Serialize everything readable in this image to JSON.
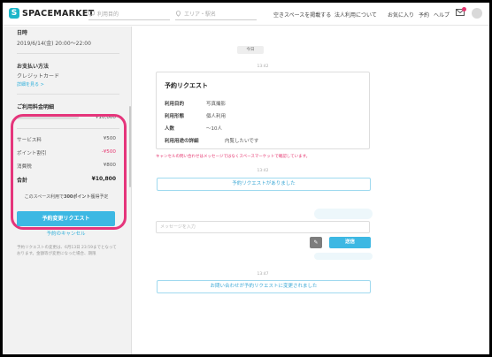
{
  "header": {
    "logo_text": "SPACEMARKET",
    "search_purpose_placeholder": "利用目的",
    "search_area_placeholder": "エリア・駅名",
    "nav": [
      "空きスペースを掲載する",
      "法人利用について",
      "お気に入り",
      "予約",
      "ヘルプ"
    ]
  },
  "sidebar": {
    "date_label": "日時",
    "date_value": "2019/6/14(金) 20:00〜22:00",
    "payment_label": "お支払い方法",
    "payment_value": "クレジットカード",
    "payment_link": "詳細を見る >",
    "bill": {
      "title": "ご利用料金明細",
      "space_price": "¥10,000",
      "rows": [
        {
          "label": "サービス料",
          "value": "¥500"
        },
        {
          "label": "ポイント割引",
          "value": "-¥500"
        },
        {
          "label": "消費税",
          "value": "¥800"
        }
      ],
      "total_label": "合計",
      "total_value": "¥10,800",
      "points_hint_pre": "このスペース利用で",
      "points_hint_bold": "300ポイント",
      "points_hint_post": "獲得予定"
    },
    "change_button": "予約変更リクエスト",
    "cancel_link": "予約のキャンセル",
    "note": "予約リクエストの変更は、6月13日 23:59までとなっております。金額等が変更になった場合、期限"
  },
  "main": {
    "date_pill": "今日",
    "times": [
      "13:42",
      "13:42",
      "13:47"
    ],
    "request_card": {
      "title": "予約リクエスト",
      "rows": [
        {
          "k": "利用目的",
          "v": "写真撮影"
        },
        {
          "k": "利用形態",
          "v": "個人利用"
        },
        {
          "k": "人数",
          "v": "〜10人"
        },
        {
          "k": "利用用途の詳細",
          "v": "内覧したいです"
        }
      ]
    },
    "warning": "キャンセルの問い合わせはメッセージではなくスペースマーケットで確認しています。",
    "request_received": "予約リクエストがありました",
    "message_placeholder": "メッセージを入力",
    "send_button": "送信",
    "attach_icon_glyph": "✎",
    "inquiry_changed": "お問い合わせが予約リクエストに変更されました"
  },
  "colors": {
    "accent": "#3db8e3",
    "highlight": "#e5357b",
    "warning": "#e5356f"
  }
}
